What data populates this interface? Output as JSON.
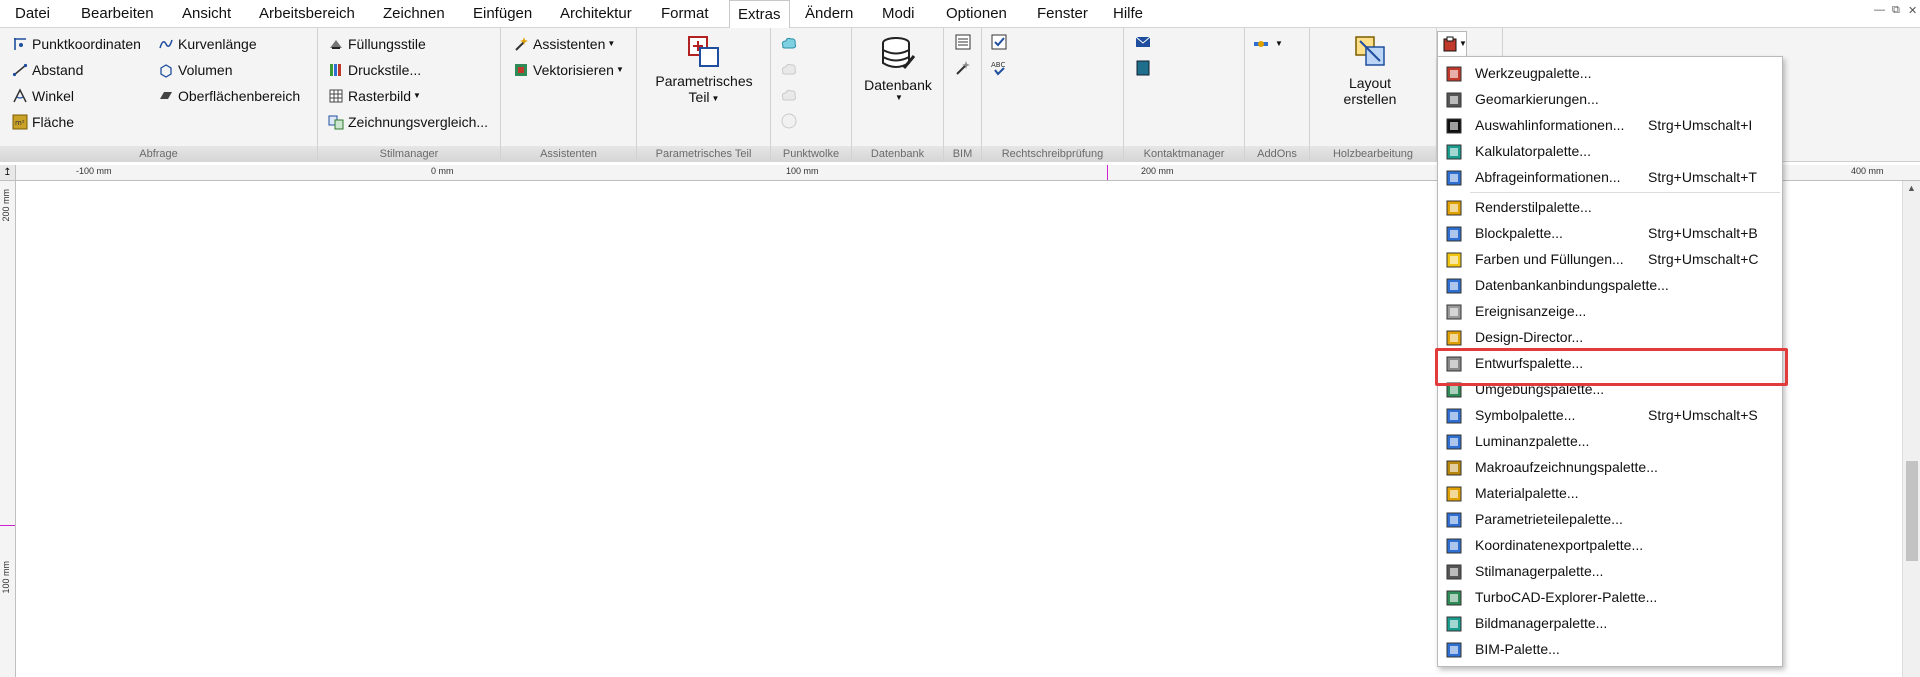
{
  "menubar": {
    "items": [
      "Datei",
      "Bearbeiten",
      "Ansicht",
      "Arbeitsbereich",
      "Zeichnen",
      "Einfügen",
      "Architektur",
      "Format",
      "Extras",
      "Ändern",
      "Modi",
      "Optionen",
      "Fenster",
      "Hilfe"
    ],
    "active": "Extras"
  },
  "ribbon": {
    "abfrage": {
      "title": "Abfrage",
      "punktkoordinaten": "Punktkoordinaten",
      "abstand": "Abstand",
      "winkel": "Winkel",
      "flaeche": "Fläche",
      "kurvenlaenge": "Kurvenlänge",
      "volumen": "Volumen",
      "oberflaechenbereich": "Oberflächenbereich"
    },
    "stilmanager": {
      "title": "Stilmanager",
      "fuellungsstile": "Füllungsstile",
      "druckstile": "Druckstile...",
      "rasterbild": "Rasterbild",
      "zeichnungsvergleich": "Zeichnungsvergleich..."
    },
    "assistenten": {
      "title": "Assistenten",
      "assistenten": "Assistenten",
      "vektorisieren": "Vektorisieren"
    },
    "parametrisches_teil": {
      "title": "Parametrisches Teil",
      "line1": "Parametrisches",
      "line2": "Teil"
    },
    "punktwolke": {
      "title": "Punktwolke"
    },
    "datenbank": {
      "title": "Datenbank",
      "label": "Datenbank"
    },
    "bim": {
      "title": "BIM"
    },
    "rechtschreibpruefung": {
      "title": "Rechtschreibprüfung"
    },
    "kontaktmanager": {
      "title": "Kontaktmanager"
    },
    "addons": {
      "title": "AddOns"
    },
    "holzbearbeitung": {
      "title": "Holzbearbeitung",
      "line1": "Layout",
      "line2": "erstellen"
    }
  },
  "ruler": {
    "h_labels": [
      "-100 mm",
      "0 mm",
      "100 mm",
      "200 mm",
      "400 mm"
    ],
    "v_labels": [
      "200 mm",
      "100 mm"
    ]
  },
  "dropdown": {
    "items": [
      {
        "label": "Werkzeugpalette...",
        "shortcut": "",
        "icon": "toolbox-icon"
      },
      {
        "label": "Geomarkierungen...",
        "shortcut": "",
        "icon": "geomarker-icon"
      },
      {
        "label": "Auswahlinformationen...",
        "shortcut": "Strg+Umschalt+I",
        "icon": "cursor-icon"
      },
      {
        "label": "Kalkulatorpalette...",
        "shortcut": "",
        "icon": "calculator-icon"
      },
      {
        "label": "Abfrageinformationen...",
        "shortcut": "Strg+Umschalt+T",
        "icon": "query-icon"
      },
      {
        "label": "Renderstilpalette...",
        "shortcut": "",
        "icon": "render-icon"
      },
      {
        "label": "Blockpalette...",
        "shortcut": "Strg+Umschalt+B",
        "icon": "block-icon"
      },
      {
        "label": "Farben und Füllungen...",
        "shortcut": "Strg+Umschalt+C",
        "icon": "colors-icon"
      },
      {
        "label": "Datenbankanbindungspalette...",
        "shortcut": "",
        "icon": "database-link-icon"
      },
      {
        "label": "Ereignisanzeige...",
        "shortcut": "",
        "icon": "event-viewer-icon"
      },
      {
        "label": "Design-Director...",
        "shortcut": "",
        "icon": "design-director-icon"
      },
      {
        "label": "Entwurfspalette...",
        "shortcut": "",
        "icon": "draft-palette-icon"
      },
      {
        "label": "Umgebungspalette...",
        "shortcut": "",
        "icon": "environment-icon"
      },
      {
        "label": "Symbolpalette...",
        "shortcut": "Strg+Umschalt+S",
        "icon": "symbol-icon"
      },
      {
        "label": "Luminanzpalette...",
        "shortcut": "",
        "icon": "luminance-icon"
      },
      {
        "label": "Makroaufzeichnungspalette...",
        "shortcut": "",
        "icon": "macro-icon"
      },
      {
        "label": "Materialpalette...",
        "shortcut": "",
        "icon": "material-icon"
      },
      {
        "label": "Parametrieteilepalette...",
        "shortcut": "",
        "icon": "parametric-parts-icon"
      },
      {
        "label": "Koordinatenexportpalette...",
        "shortcut": "",
        "icon": "coordinate-export-icon"
      },
      {
        "label": "Stilmanagerpalette...",
        "shortcut": "",
        "icon": "style-manager-icon"
      },
      {
        "label": "TurboCAD-Explorer-Palette...",
        "shortcut": "",
        "icon": "explorer-icon"
      },
      {
        "label": "Bildmanagerpalette...",
        "shortcut": "",
        "icon": "image-manager-icon"
      },
      {
        "label": "BIM-Palette...",
        "shortcut": "",
        "icon": "bim-icon"
      }
    ],
    "highlighted": "Entwurfspalette..."
  },
  "colors": {
    "highlight": "#e23b3b",
    "ribbon_bg": "#f4f4f4",
    "group_title_bg": "#dcdcdc"
  }
}
